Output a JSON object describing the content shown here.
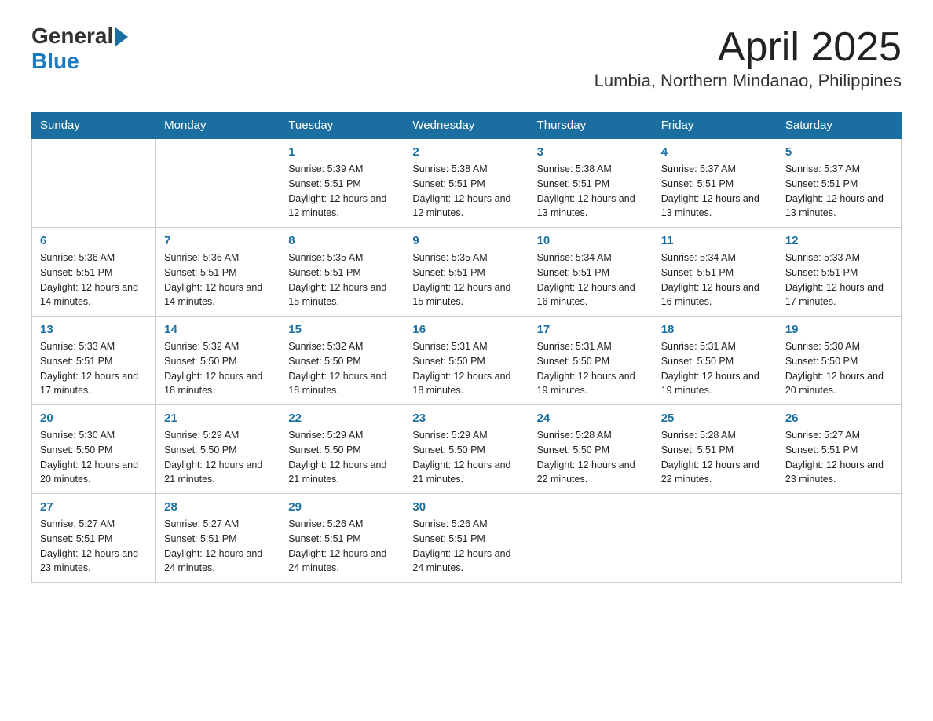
{
  "header": {
    "logo_general": "General",
    "logo_blue": "Blue",
    "month_title": "April 2025",
    "location": "Lumbia, Northern Mindanao, Philippines"
  },
  "weekdays": [
    "Sunday",
    "Monday",
    "Tuesday",
    "Wednesday",
    "Thursday",
    "Friday",
    "Saturday"
  ],
  "weeks": [
    [
      {
        "day": "",
        "sunrise": "",
        "sunset": "",
        "daylight": ""
      },
      {
        "day": "",
        "sunrise": "",
        "sunset": "",
        "daylight": ""
      },
      {
        "day": "1",
        "sunrise": "Sunrise: 5:39 AM",
        "sunset": "Sunset: 5:51 PM",
        "daylight": "Daylight: 12 hours and 12 minutes."
      },
      {
        "day": "2",
        "sunrise": "Sunrise: 5:38 AM",
        "sunset": "Sunset: 5:51 PM",
        "daylight": "Daylight: 12 hours and 12 minutes."
      },
      {
        "day": "3",
        "sunrise": "Sunrise: 5:38 AM",
        "sunset": "Sunset: 5:51 PM",
        "daylight": "Daylight: 12 hours and 13 minutes."
      },
      {
        "day": "4",
        "sunrise": "Sunrise: 5:37 AM",
        "sunset": "Sunset: 5:51 PM",
        "daylight": "Daylight: 12 hours and 13 minutes."
      },
      {
        "day": "5",
        "sunrise": "Sunrise: 5:37 AM",
        "sunset": "Sunset: 5:51 PM",
        "daylight": "Daylight: 12 hours and 13 minutes."
      }
    ],
    [
      {
        "day": "6",
        "sunrise": "Sunrise: 5:36 AM",
        "sunset": "Sunset: 5:51 PM",
        "daylight": "Daylight: 12 hours and 14 minutes."
      },
      {
        "day": "7",
        "sunrise": "Sunrise: 5:36 AM",
        "sunset": "Sunset: 5:51 PM",
        "daylight": "Daylight: 12 hours and 14 minutes."
      },
      {
        "day": "8",
        "sunrise": "Sunrise: 5:35 AM",
        "sunset": "Sunset: 5:51 PM",
        "daylight": "Daylight: 12 hours and 15 minutes."
      },
      {
        "day": "9",
        "sunrise": "Sunrise: 5:35 AM",
        "sunset": "Sunset: 5:51 PM",
        "daylight": "Daylight: 12 hours and 15 minutes."
      },
      {
        "day": "10",
        "sunrise": "Sunrise: 5:34 AM",
        "sunset": "Sunset: 5:51 PM",
        "daylight": "Daylight: 12 hours and 16 minutes."
      },
      {
        "day": "11",
        "sunrise": "Sunrise: 5:34 AM",
        "sunset": "Sunset: 5:51 PM",
        "daylight": "Daylight: 12 hours and 16 minutes."
      },
      {
        "day": "12",
        "sunrise": "Sunrise: 5:33 AM",
        "sunset": "Sunset: 5:51 PM",
        "daylight": "Daylight: 12 hours and 17 minutes."
      }
    ],
    [
      {
        "day": "13",
        "sunrise": "Sunrise: 5:33 AM",
        "sunset": "Sunset: 5:51 PM",
        "daylight": "Daylight: 12 hours and 17 minutes."
      },
      {
        "day": "14",
        "sunrise": "Sunrise: 5:32 AM",
        "sunset": "Sunset: 5:50 PM",
        "daylight": "Daylight: 12 hours and 18 minutes."
      },
      {
        "day": "15",
        "sunrise": "Sunrise: 5:32 AM",
        "sunset": "Sunset: 5:50 PM",
        "daylight": "Daylight: 12 hours and 18 minutes."
      },
      {
        "day": "16",
        "sunrise": "Sunrise: 5:31 AM",
        "sunset": "Sunset: 5:50 PM",
        "daylight": "Daylight: 12 hours and 18 minutes."
      },
      {
        "day": "17",
        "sunrise": "Sunrise: 5:31 AM",
        "sunset": "Sunset: 5:50 PM",
        "daylight": "Daylight: 12 hours and 19 minutes."
      },
      {
        "day": "18",
        "sunrise": "Sunrise: 5:31 AM",
        "sunset": "Sunset: 5:50 PM",
        "daylight": "Daylight: 12 hours and 19 minutes."
      },
      {
        "day": "19",
        "sunrise": "Sunrise: 5:30 AM",
        "sunset": "Sunset: 5:50 PM",
        "daylight": "Daylight: 12 hours and 20 minutes."
      }
    ],
    [
      {
        "day": "20",
        "sunrise": "Sunrise: 5:30 AM",
        "sunset": "Sunset: 5:50 PM",
        "daylight": "Daylight: 12 hours and 20 minutes."
      },
      {
        "day": "21",
        "sunrise": "Sunrise: 5:29 AM",
        "sunset": "Sunset: 5:50 PM",
        "daylight": "Daylight: 12 hours and 21 minutes."
      },
      {
        "day": "22",
        "sunrise": "Sunrise: 5:29 AM",
        "sunset": "Sunset: 5:50 PM",
        "daylight": "Daylight: 12 hours and 21 minutes."
      },
      {
        "day": "23",
        "sunrise": "Sunrise: 5:29 AM",
        "sunset": "Sunset: 5:50 PM",
        "daylight": "Daylight: 12 hours and 21 minutes."
      },
      {
        "day": "24",
        "sunrise": "Sunrise: 5:28 AM",
        "sunset": "Sunset: 5:50 PM",
        "daylight": "Daylight: 12 hours and 22 minutes."
      },
      {
        "day": "25",
        "sunrise": "Sunrise: 5:28 AM",
        "sunset": "Sunset: 5:51 PM",
        "daylight": "Daylight: 12 hours and 22 minutes."
      },
      {
        "day": "26",
        "sunrise": "Sunrise: 5:27 AM",
        "sunset": "Sunset: 5:51 PM",
        "daylight": "Daylight: 12 hours and 23 minutes."
      }
    ],
    [
      {
        "day": "27",
        "sunrise": "Sunrise: 5:27 AM",
        "sunset": "Sunset: 5:51 PM",
        "daylight": "Daylight: 12 hours and 23 minutes."
      },
      {
        "day": "28",
        "sunrise": "Sunrise: 5:27 AM",
        "sunset": "Sunset: 5:51 PM",
        "daylight": "Daylight: 12 hours and 24 minutes."
      },
      {
        "day": "29",
        "sunrise": "Sunrise: 5:26 AM",
        "sunset": "Sunset: 5:51 PM",
        "daylight": "Daylight: 12 hours and 24 minutes."
      },
      {
        "day": "30",
        "sunrise": "Sunrise: 5:26 AM",
        "sunset": "Sunset: 5:51 PM",
        "daylight": "Daylight: 12 hours and 24 minutes."
      },
      {
        "day": "",
        "sunrise": "",
        "sunset": "",
        "daylight": ""
      },
      {
        "day": "",
        "sunrise": "",
        "sunset": "",
        "daylight": ""
      },
      {
        "day": "",
        "sunrise": "",
        "sunset": "",
        "daylight": ""
      }
    ]
  ]
}
